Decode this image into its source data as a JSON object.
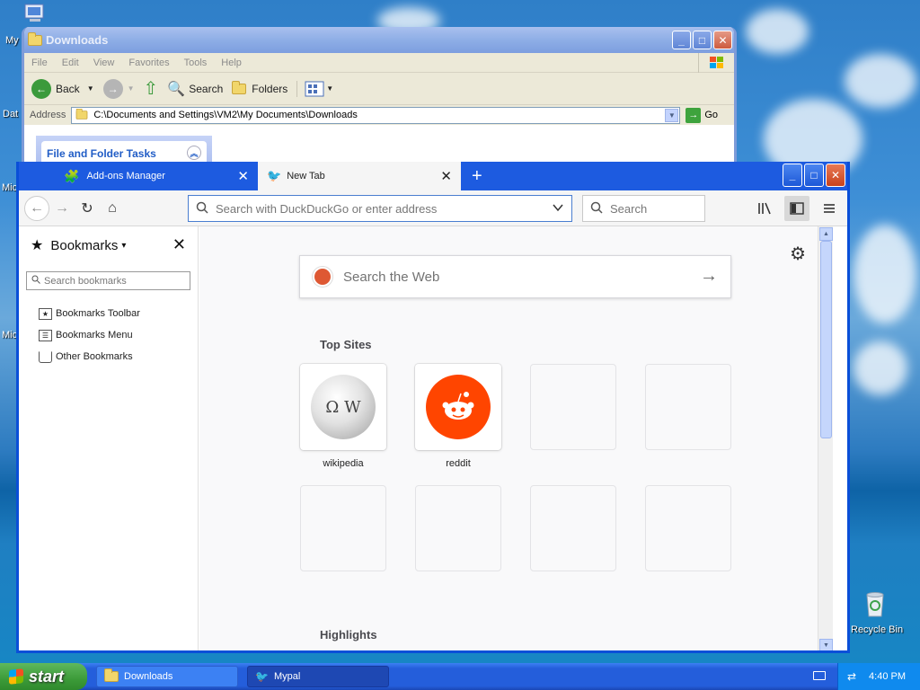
{
  "desktop": {
    "icons": [
      {
        "label": "My"
      },
      {
        "label": "Dat"
      },
      {
        "label": "Mic"
      },
      {
        "label": "Mic"
      },
      {
        "label": "Recycle Bin"
      }
    ]
  },
  "explorer": {
    "title": "Downloads",
    "menu": [
      "File",
      "Edit",
      "View",
      "Favorites",
      "Tools",
      "Help"
    ],
    "toolbar": {
      "back": "Back",
      "search": "Search",
      "folders": "Folders"
    },
    "address_label": "Address",
    "address_value": "C:\\Documents and Settings\\VM2\\My Documents\\Downloads",
    "go_label": "Go",
    "task_pane_title": "File and Folder Tasks"
  },
  "firefox": {
    "tabs": [
      {
        "label": "Add-ons Manager",
        "active": false
      },
      {
        "label": "New Tab",
        "active": true
      }
    ],
    "url_placeholder": "Search with DuckDuckGo or enter address",
    "search_placeholder": "Search",
    "sidebar": {
      "title": "Bookmarks",
      "search_placeholder": "Search bookmarks",
      "items": [
        {
          "label": "Bookmarks Toolbar"
        },
        {
          "label": "Bookmarks Menu"
        },
        {
          "label": "Other Bookmarks"
        }
      ]
    },
    "newtab": {
      "web_search_placeholder": "Search the Web",
      "top_sites_title": "Top Sites",
      "top_sites": [
        {
          "label": "wikipedia"
        },
        {
          "label": "reddit"
        }
      ],
      "highlights_title": "Highlights"
    }
  },
  "taskbar": {
    "start_label": "start",
    "buttons": [
      {
        "label": "Downloads"
      },
      {
        "label": "Mypal"
      }
    ],
    "clock": "4:40 PM"
  },
  "colors": {
    "xp_blue": "#245edb",
    "firefox_frame": "#0a4fd8",
    "reddit_orange": "#ff4500",
    "ddg_orange": "#de5833"
  }
}
